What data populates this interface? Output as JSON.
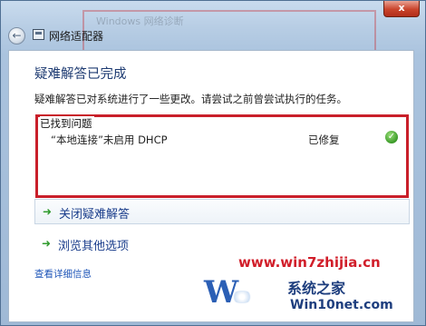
{
  "window": {
    "title": "网络适配器",
    "close_label": "x",
    "background_text": "Windows 网络诊断"
  },
  "content": {
    "heading": "疑难解答已完成",
    "description": "疑难解答已对系统进行了一些更改。请尝试之前曾尝试执行的任务。",
    "found": {
      "label": "已找到问题",
      "issue": "“本地连接”未启用 DHCP",
      "status": "已修复",
      "status_icon": "check-circle-icon"
    },
    "actions": [
      {
        "label": "关闭疑难解答",
        "icon": "green-arrow-icon"
      },
      {
        "label": "浏览其他选项",
        "icon": "green-arrow-icon"
      }
    ],
    "details_link": "查看详细信息"
  },
  "watermark": {
    "url": "www.win7zhijia.cn",
    "brand": "系统之家",
    "domain": "Win10net.com"
  },
  "colors": {
    "accent_red": "#c91f2a",
    "heading_blue": "#1e3b72",
    "link_blue": "#1e55b8",
    "arrow_green": "#2f9b2c"
  }
}
